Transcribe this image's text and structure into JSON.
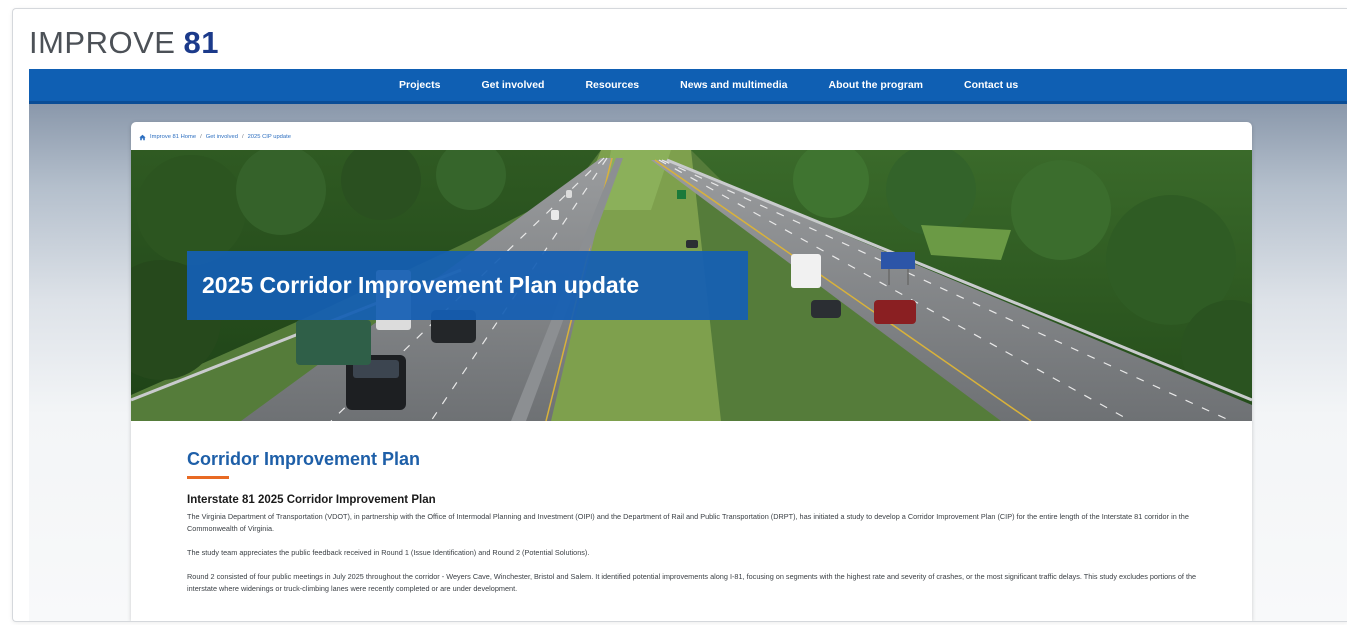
{
  "logo": {
    "word": "IMPROVE",
    "number": "81"
  },
  "nav": {
    "items": [
      {
        "label": "Projects"
      },
      {
        "label": "Get involved"
      },
      {
        "label": "Resources"
      },
      {
        "label": "News and multimedia"
      },
      {
        "label": "About the program"
      },
      {
        "label": "Contact us"
      }
    ]
  },
  "breadcrumb": {
    "home": "Improve 81 Home",
    "separator": "/",
    "parent": "Get involved",
    "current": "2025 CIP update"
  },
  "hero": {
    "title": "2025 Corridor Improvement Plan update"
  },
  "content": {
    "heading": "Corridor Improvement Plan",
    "subheading": "Interstate 81 2025 Corridor Improvement Plan",
    "paragraphs": [
      "The Virginia Department of Transportation (VDOT), in partnership with the Office of Intermodal Planning and Investment (OIPI) and the Department of Rail and Public Transportation (DRPT), has initiated a study to develop a Corridor Improvement Plan (CIP) for the entire length of the Interstate 81 corridor in the Commonwealth of Virginia.",
      "The study team appreciates the public feedback received in Round 1 (Issue Identification) and Round 2 (Potential Solutions).",
      "Round 2 consisted of four public meetings in July 2025 throughout the corridor - Weyers Cave, Winchester, Bristol and Salem. It identified potential improvements along I-81, focusing on segments with the highest rate and severity of crashes, or the most significant traffic delays. This study excludes portions of the interstate where widenings or truck-climbing lanes were recently completed or are under development."
    ]
  },
  "colors": {
    "nav_bg": "#0f5fb3",
    "logo_number": "#1b3a8a",
    "heading": "#1e5fa8",
    "accent_underline": "#e86a23",
    "hero_title_box": "#145fb4"
  },
  "icons": {
    "breadcrumb_home": "home-icon"
  }
}
